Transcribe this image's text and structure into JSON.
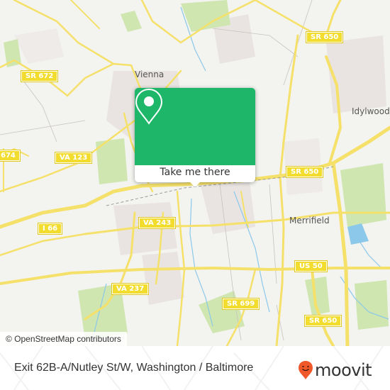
{
  "map": {
    "attribution": "© OpenStreetMap contributors",
    "place_labels": [
      {
        "name": "Vienna"
      },
      {
        "name": "Idylwood"
      },
      {
        "name": "Merrifield"
      }
    ],
    "route_shields": [
      {
        "label": "SR 650"
      },
      {
        "label": "SR 672"
      },
      {
        "label": "VA 123"
      },
      {
        "label": "674"
      },
      {
        "label": "SR 650"
      },
      {
        "label": "I 66"
      },
      {
        "label": "VA 243"
      },
      {
        "label": "US 50"
      },
      {
        "label": "VA 237"
      },
      {
        "label": "SR 699"
      },
      {
        "label": "SR 650"
      }
    ],
    "colors": {
      "background": "#f3f3f0",
      "road": "#f5e16a",
      "park": "#cfe6b0",
      "water": "#8cc8ea",
      "popup_accent": "#1eb76a"
    }
  },
  "popup": {
    "icon": "map-pin-icon",
    "button_label": "Take me there"
  },
  "footer": {
    "title": "Exit 62B-A/Nutley St/W, Washington / Baltimore",
    "brand": "moovit",
    "brand_icon": "moovit-smile-pin-icon",
    "brand_color": "#f0582a"
  }
}
